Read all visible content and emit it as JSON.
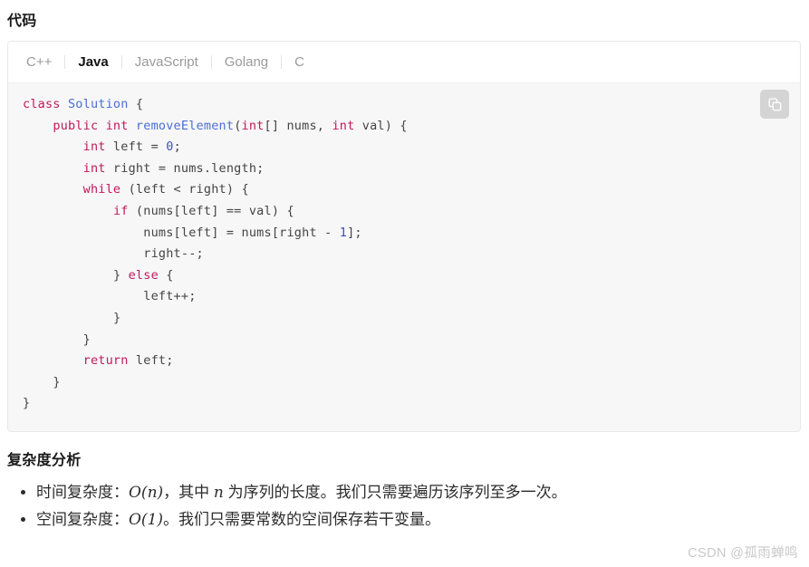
{
  "page": {
    "section_title": "代码",
    "complexity_title": "复杂度分析"
  },
  "tabs": [
    {
      "label": "C++",
      "active": false
    },
    {
      "label": "Java",
      "active": true
    },
    {
      "label": "JavaScript",
      "active": false
    },
    {
      "label": "Golang",
      "active": false
    },
    {
      "label": "C",
      "active": false
    }
  ],
  "code": {
    "language": "Java",
    "copy_icon": "copy-icon",
    "lines": [
      {
        "indent": 0,
        "tokens": [
          {
            "t": "kw",
            "v": "class"
          },
          {
            "t": "pl",
            "v": " "
          },
          {
            "t": "fn",
            "v": "Solution"
          },
          {
            "t": "pl",
            "v": " {"
          }
        ]
      },
      {
        "indent": 1,
        "tokens": [
          {
            "t": "kw",
            "v": "public"
          },
          {
            "t": "pl",
            "v": " "
          },
          {
            "t": "kw",
            "v": "int"
          },
          {
            "t": "pl",
            "v": " "
          },
          {
            "t": "fn",
            "v": "removeElement"
          },
          {
            "t": "pl",
            "v": "("
          },
          {
            "t": "kw",
            "v": "int"
          },
          {
            "t": "pl",
            "v": "[] nums, "
          },
          {
            "t": "kw",
            "v": "int"
          },
          {
            "t": "pl",
            "v": " val) {"
          }
        ]
      },
      {
        "indent": 2,
        "tokens": [
          {
            "t": "kw",
            "v": "int"
          },
          {
            "t": "pl",
            "v": " left = "
          },
          {
            "t": "num",
            "v": "0"
          },
          {
            "t": "pl",
            "v": ";"
          }
        ]
      },
      {
        "indent": 2,
        "tokens": [
          {
            "t": "kw",
            "v": "int"
          },
          {
            "t": "pl",
            "v": " right = nums.length;"
          }
        ]
      },
      {
        "indent": 2,
        "tokens": [
          {
            "t": "kw",
            "v": "while"
          },
          {
            "t": "pl",
            "v": " (left < right) {"
          }
        ]
      },
      {
        "indent": 3,
        "tokens": [
          {
            "t": "kw",
            "v": "if"
          },
          {
            "t": "pl",
            "v": " (nums[left] == val) {"
          }
        ]
      },
      {
        "indent": 4,
        "tokens": [
          {
            "t": "pl",
            "v": "nums[left] = nums[right - "
          },
          {
            "t": "num",
            "v": "1"
          },
          {
            "t": "pl",
            "v": "];"
          }
        ]
      },
      {
        "indent": 4,
        "tokens": [
          {
            "t": "pl",
            "v": "right--;"
          }
        ]
      },
      {
        "indent": 3,
        "tokens": [
          {
            "t": "pl",
            "v": "} "
          },
          {
            "t": "kw",
            "v": "else"
          },
          {
            "t": "pl",
            "v": " {"
          }
        ]
      },
      {
        "indent": 4,
        "tokens": [
          {
            "t": "pl",
            "v": "left++;"
          }
        ]
      },
      {
        "indent": 3,
        "tokens": [
          {
            "t": "pl",
            "v": "}"
          }
        ]
      },
      {
        "indent": 2,
        "tokens": [
          {
            "t": "pl",
            "v": "}"
          }
        ]
      },
      {
        "indent": 2,
        "tokens": [
          {
            "t": "kw",
            "v": "return"
          },
          {
            "t": "pl",
            "v": " left;"
          }
        ]
      },
      {
        "indent": 1,
        "tokens": [
          {
            "t": "pl",
            "v": "}"
          }
        ]
      },
      {
        "indent": 0,
        "tokens": [
          {
            "t": "pl",
            "v": "}"
          }
        ]
      }
    ]
  },
  "complexity": {
    "items": [
      {
        "prefix": "时间复杂度：",
        "math": "O(n)",
        "mid": "，其中 ",
        "math2": "n",
        "suffix": " 为序列的长度。我们只需要遍历该序列至多一次。"
      },
      {
        "prefix": "空间复杂度：",
        "math": "O(1)",
        "mid": "",
        "math2": "",
        "suffix": "。我们只需要常数的空间保存若干变量。"
      }
    ]
  },
  "watermark": {
    "text": "CSDN @孤雨蝉鸣"
  },
  "colors": {
    "keyword": "#c2185b",
    "function": "#4a6fd4",
    "number": "#3f51b5",
    "plain": "#444444",
    "code_bg": "#f7f7f7",
    "card_border": "#e8e8e8",
    "tab_inactive": "#9a9a9a",
    "tab_active": "#111111",
    "watermark": "#c9c9c9"
  }
}
